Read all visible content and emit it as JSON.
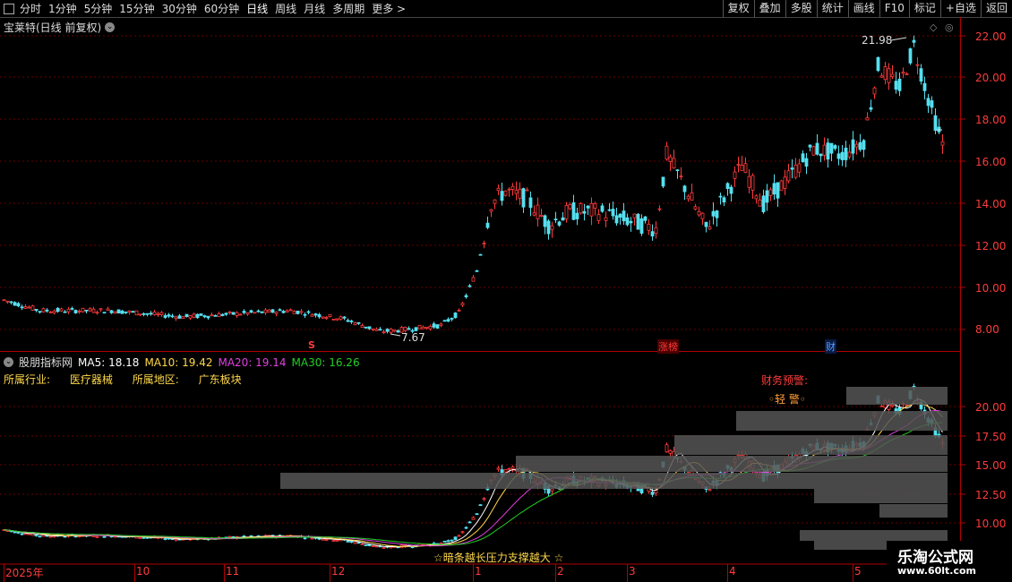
{
  "toolbar": {
    "periods": [
      "分时",
      "1分钟",
      "5分钟",
      "15分钟",
      "30分钟",
      "60分钟",
      "日线",
      "周线",
      "月线",
      "多周期",
      "更多 >"
    ],
    "selected": "日线",
    "right_buttons": [
      "复权",
      "叠加",
      "多股",
      "统计",
      "画线",
      "F10",
      "标记",
      "+自选",
      "返回"
    ]
  },
  "stock": {
    "title": "宝莱特(日线 前复权)"
  },
  "price_axis": {
    "labels": [
      "22.00",
      "20.00",
      "18.00",
      "16.00",
      "14.00",
      "12.00",
      "10.00",
      "8.00"
    ]
  },
  "annotations": {
    "high": "21.98",
    "low": "7.67",
    "s_mark": "S",
    "zhangbang": "涨榜",
    "cai": "财"
  },
  "indicator": {
    "name": "股朋指标网",
    "ma5": "MA5: 18.18",
    "ma10": "MA10: 19.42",
    "ma20": "MA20: 19.14",
    "ma30": "MA30: 16.26",
    "industry_label": "所属行业:",
    "industry": "医疗器械",
    "region_label": "所属地区:",
    "region": "广东板块",
    "warn_title": "财务预警:",
    "warn_level": "◦轻 警◦",
    "bottom_text": "☆暗条越长压力支撑越大 ☆",
    "axis": [
      "20.00",
      "17.50",
      "15.00",
      "12.50",
      "10.00"
    ]
  },
  "x_axis": [
    "2025年",
    "10",
    "11",
    "12",
    "1",
    "2",
    "3",
    "4",
    "5"
  ],
  "watermark": {
    "cn": "乐淘公式网",
    "url": "www.60lt.com"
  },
  "colors": {
    "up": "#ff3b3b",
    "down": "#54e0f0",
    "ma5": "#ffffff",
    "ma10": "#ffd84a",
    "ma20": "#e040e0",
    "ma30": "#22d022"
  }
}
